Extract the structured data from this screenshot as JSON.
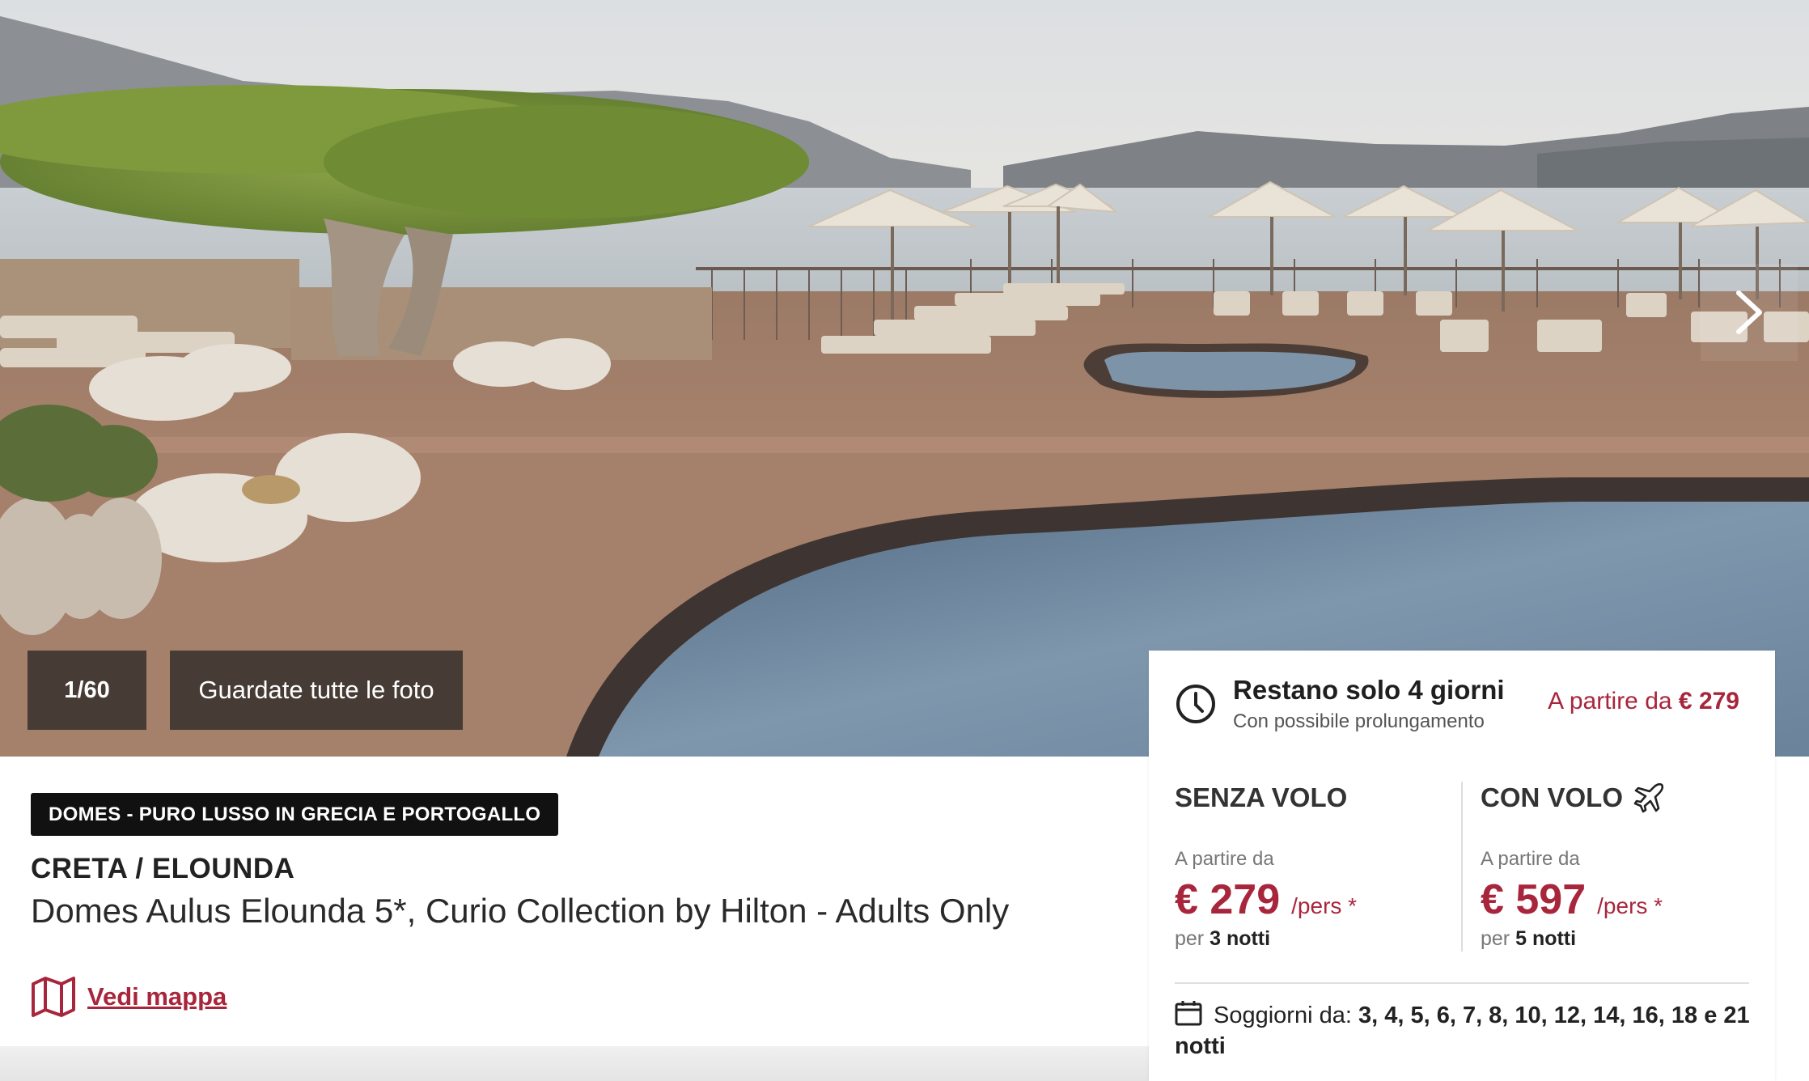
{
  "gallery": {
    "counter": "1/60",
    "all_photos_label": "Guardate tutte le foto"
  },
  "hotel": {
    "tag": "DOMES - PURO LUSSO IN GRECIA E PORTOGALLO",
    "location": "CRETA / ELOUNDA",
    "name": "Domes Aulus Elounda 5*, Curio Collection by Hilton - Adults Only",
    "map_link": "Vedi mappa"
  },
  "offer": {
    "remaining_title": "Restano solo 4 giorni",
    "extension": "Con possibile prolungamento",
    "from_label": "A partire da",
    "from_price": "€ 279"
  },
  "options": {
    "no_flight": {
      "title": "SENZA VOLO",
      "from_label": "A partire da",
      "price": "€ 279",
      "per": "/pers *",
      "nights_prefix": "per",
      "nights": "3 notti"
    },
    "with_flight": {
      "title": "CON VOLO",
      "from_label": "A partire da",
      "price": "€ 597",
      "per": "/pers *",
      "nights_prefix": "per",
      "nights": "5 notti"
    }
  },
  "stays": {
    "label": "Soggiorni da:",
    "values": "3, 4, 5, 6, 7, 8, 10, 12, 14, 16, 18 e 21 notti"
  },
  "icons": {
    "clock": "clock-icon",
    "plane": "plane-icon",
    "map": "map-icon",
    "calendar": "calendar-icon",
    "next": "chevron-right-icon"
  },
  "colors": {
    "accent": "#a8263c",
    "tag_bg": "#111111",
    "overlay": "#322d2a"
  }
}
